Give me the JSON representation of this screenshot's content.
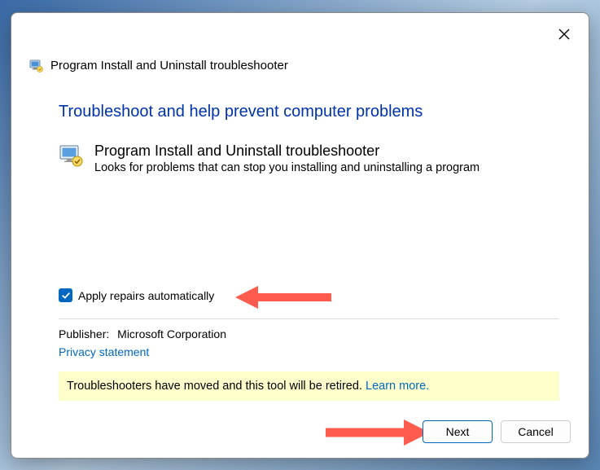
{
  "window": {
    "title": "Program Install and Uninstall troubleshooter"
  },
  "content": {
    "heading": "Troubleshoot and help prevent computer problems",
    "program_title": "Program Install and Uninstall troubleshooter",
    "program_desc": "Looks for problems that can stop you installing and uninstalling a program",
    "checkbox_label": "Apply repairs automatically",
    "publisher_label": "Publisher:",
    "publisher_name": "Microsoft Corporation",
    "privacy": "Privacy statement",
    "notice_text": "Troubleshooters have moved and this tool will be retired. ",
    "notice_learn": "Learn more."
  },
  "buttons": {
    "next": "Next",
    "cancel": "Cancel"
  },
  "colors": {
    "accent": "#0067c0",
    "heading": "#0033aa",
    "notice_bg": "#ffffcc",
    "arrow": "#ff5b4f"
  }
}
